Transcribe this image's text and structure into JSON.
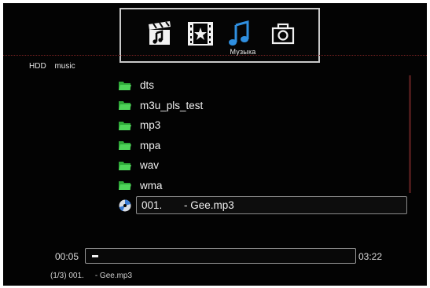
{
  "header": {
    "categories": [
      {
        "name": "video",
        "icon": "video-clapper-icon",
        "active": false
      },
      {
        "name": "movie",
        "icon": "filmstrip-star-icon",
        "active": false
      },
      {
        "name": "music",
        "icon": "music-note-icon",
        "active": true
      },
      {
        "name": "photo",
        "icon": "camera-icon",
        "active": false
      }
    ],
    "active_label": "Музыка"
  },
  "breadcrumb": {
    "drive": "HDD",
    "folder": "music"
  },
  "list": {
    "items": [
      {
        "type": "folder",
        "label": "dts"
      },
      {
        "type": "folder",
        "label": "m3u_pls_test"
      },
      {
        "type": "folder",
        "label": "mp3"
      },
      {
        "type": "folder",
        "label": "mpa"
      },
      {
        "type": "folder",
        "label": "wav"
      },
      {
        "type": "folder",
        "label": "wma"
      },
      {
        "type": "audio",
        "number": "001.",
        "label": "- Gee.mp3",
        "selected": true
      }
    ]
  },
  "player": {
    "current_time": "00:05",
    "total_time": "03:22",
    "progress_fraction": 0.025,
    "track_index": "(1/3) 001.",
    "track_title": "- Gee.mp3"
  },
  "colors": {
    "accent_music": "#2f8fe0",
    "folder_green": "#3fc64a",
    "divider": "#7a2222"
  }
}
